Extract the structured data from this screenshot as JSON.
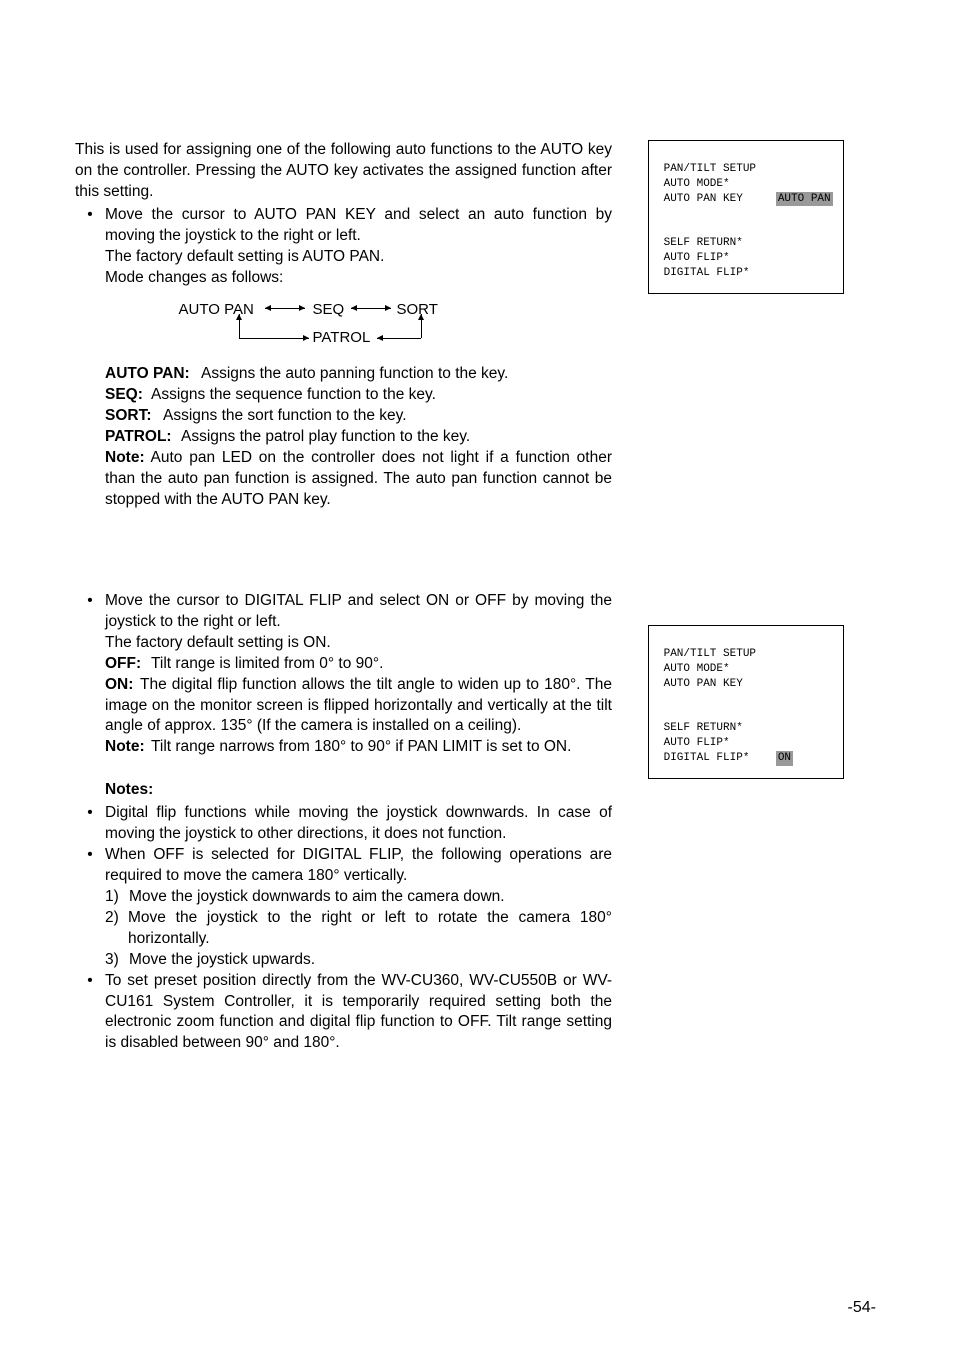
{
  "intro": "This is used for assigning one of the following auto functions to the AUTO key on the controller. Pressing the AUTO key activates the assigned function after this setting.",
  "b1_l1": "Move the cursor to AUTO PAN KEY and select an auto function by moving the joystick to the right or left.",
  "b1_l2": "The factory default setting is AUTO PAN.",
  "b1_l3": "Mode changes as follows:",
  "diagram": {
    "a": "AUTO PAN",
    "b": "SEQ",
    "c": "SORT",
    "d": "PATROL"
  },
  "d1_t": "AUTO PAN:",
  "d1_v": "Assigns the auto panning function to the key.",
  "d2_t": "SEQ:",
  "d2_v": "Assigns the sequence function to the key.",
  "d3_t": "SORT:",
  "d3_v": "Assigns the sort function to the key.",
  "d4_t": "PATROL:",
  "d4_v": "Assigns the patrol play function to the key.",
  "note1_t": "Note:",
  "note1_v": "Auto pan LED on the controller does not light if a function other than the auto pan function is assigned. The auto pan function cannot be stopped with the AUTO PAN key.",
  "b2_l1": "Move the cursor to DIGITAL FLIP and select ON or OFF by moving the joystick to the right or left.",
  "b2_l2": "The factory default setting is ON.",
  "df_off_t": "OFF:",
  "df_off_v": "Tilt range is limited from 0° to 90°.",
  "df_on_t": "ON:",
  "df_on_v": "The digital flip function allows the tilt angle to widen up to 180°. The image on the monitor screen is flipped horizontally and vertically at the tilt angle of approx. 135° (If the camera is installed on a ceiling).",
  "df_note_t": "Note:",
  "df_note_v": "Tilt range narrows from 180° to 90° if PAN LIMIT is set to ON.",
  "notes_label": "Notes:",
  "n1": "Digital flip functions while moving the joystick downwards. In case of moving the joystick to other directions, it does not function.",
  "n2": "When OFF is selected for DIGITAL FLIP, the following operations are required to move the camera 180° vertically.",
  "n2_1": "Move the joystick downwards to aim the camera down.",
  "n2_2": "Move the joystick to the right or left to rotate the camera 180° horizontally.",
  "n2_3": "Move the joystick upwards.",
  "n3": "To set preset position directly from the WV-CU360, WV-CU550B or WV-CU161 System Controller, it is temporarily required setting both the electronic zoom function and digital flip function to OFF. Tilt range setting is disabled between 90° and 180°.",
  "panel1": {
    "l1": " PAN/TILT SETUP              ",
    "l2": " AUTO MODE*       ",
    "l3": " AUTO PAN KEY     ",
    "l3v": "AUTO PAN",
    "l4": "",
    "l5": "",
    "l6": " SELF RETURN*     ",
    "l7": " AUTO FLIP*       ",
    "l8": " DIGITAL FLIP*    "
  },
  "panel2": {
    "l1": " PAN/TILT SETUP              ",
    "l2": " AUTO MODE*       ",
    "l3": " AUTO PAN KEY     ",
    "l4": "",
    "l5": "",
    "l6": " SELF RETURN*     ",
    "l7": " AUTO FLIP*       ",
    "l8": " DIGITAL FLIP*    ",
    "l8v": "ON"
  },
  "page": "-54-"
}
